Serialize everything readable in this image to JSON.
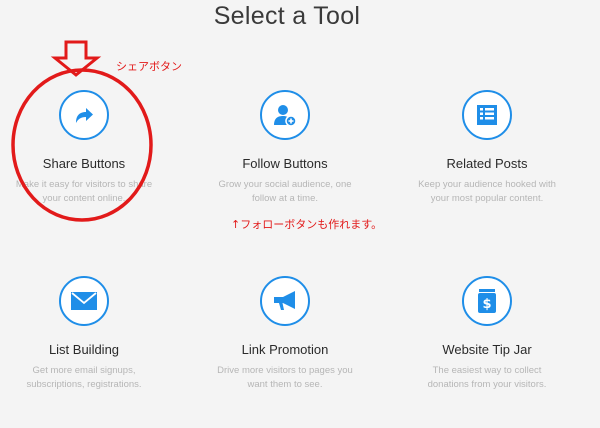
{
  "page_title": "Select a Tool",
  "tools": [
    {
      "name": "Share Buttons",
      "description_line1": "Make it easy for visitors to share",
      "description_line2": "your content online.",
      "icon": "share-arrow-icon"
    },
    {
      "name": "Follow Buttons",
      "description_line1": "Grow your social audience, one",
      "description_line2": "follow at a time.",
      "icon": "add-user-icon"
    },
    {
      "name": "Related Posts",
      "description_line1": "Keep your audience hooked with",
      "description_line2": "your most popular content.",
      "icon": "list-icon"
    },
    {
      "name": "List Building",
      "description_line1": "Get more email signups,",
      "description_line2": "subscriptions, registrations.",
      "icon": "envelope-icon"
    },
    {
      "name": "Link Promotion",
      "description_line1": "Drive more visitors to pages you",
      "description_line2": "want them to see.",
      "icon": "megaphone-icon"
    },
    {
      "name": "Website Tip Jar",
      "description_line1": "The easiest way to collect",
      "description_line2": "donations from your visitors.",
      "icon": "dollar-jar-icon"
    }
  ],
  "annotations": {
    "share_label": "シェアボタン",
    "follow_note": "↑フォローボタンも作れます。"
  },
  "colors": {
    "accent": "#1f8ee8",
    "annotation": "#e21a1a"
  }
}
